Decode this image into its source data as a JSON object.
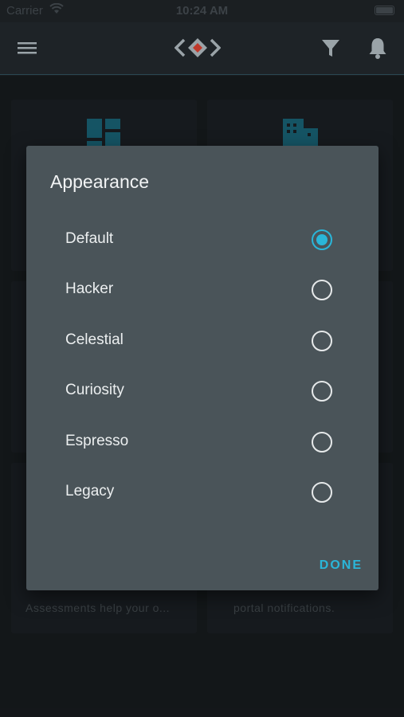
{
  "status_bar": {
    "carrier": "Carrier",
    "time": "10:24 AM"
  },
  "app_bar": {
    "menu_icon": "hamburger-menu-icon",
    "logo_icon": "brand-logo-icon",
    "filter_icon": "filter-icon",
    "bell_icon": "bell-icon"
  },
  "cards": [
    {
      "icon": "dashboard-icon",
      "description": ""
    },
    {
      "icon": "building-icon",
      "description": ""
    },
    {
      "icon": "",
      "description": "Assessments help your o..."
    },
    {
      "icon": "",
      "description": "portal notifications."
    }
  ],
  "dialog": {
    "title": "Appearance",
    "options": [
      {
        "label": "Default",
        "selected": true
      },
      {
        "label": "Hacker",
        "selected": false
      },
      {
        "label": "Celestial",
        "selected": false
      },
      {
        "label": "Curiosity",
        "selected": false
      },
      {
        "label": "Espresso",
        "selected": false
      },
      {
        "label": "Legacy",
        "selected": false
      }
    ],
    "done_label": "DONE"
  },
  "colors": {
    "accent": "#2ab6d9",
    "background": "#1b1f22",
    "dialog": "#4a5459"
  }
}
